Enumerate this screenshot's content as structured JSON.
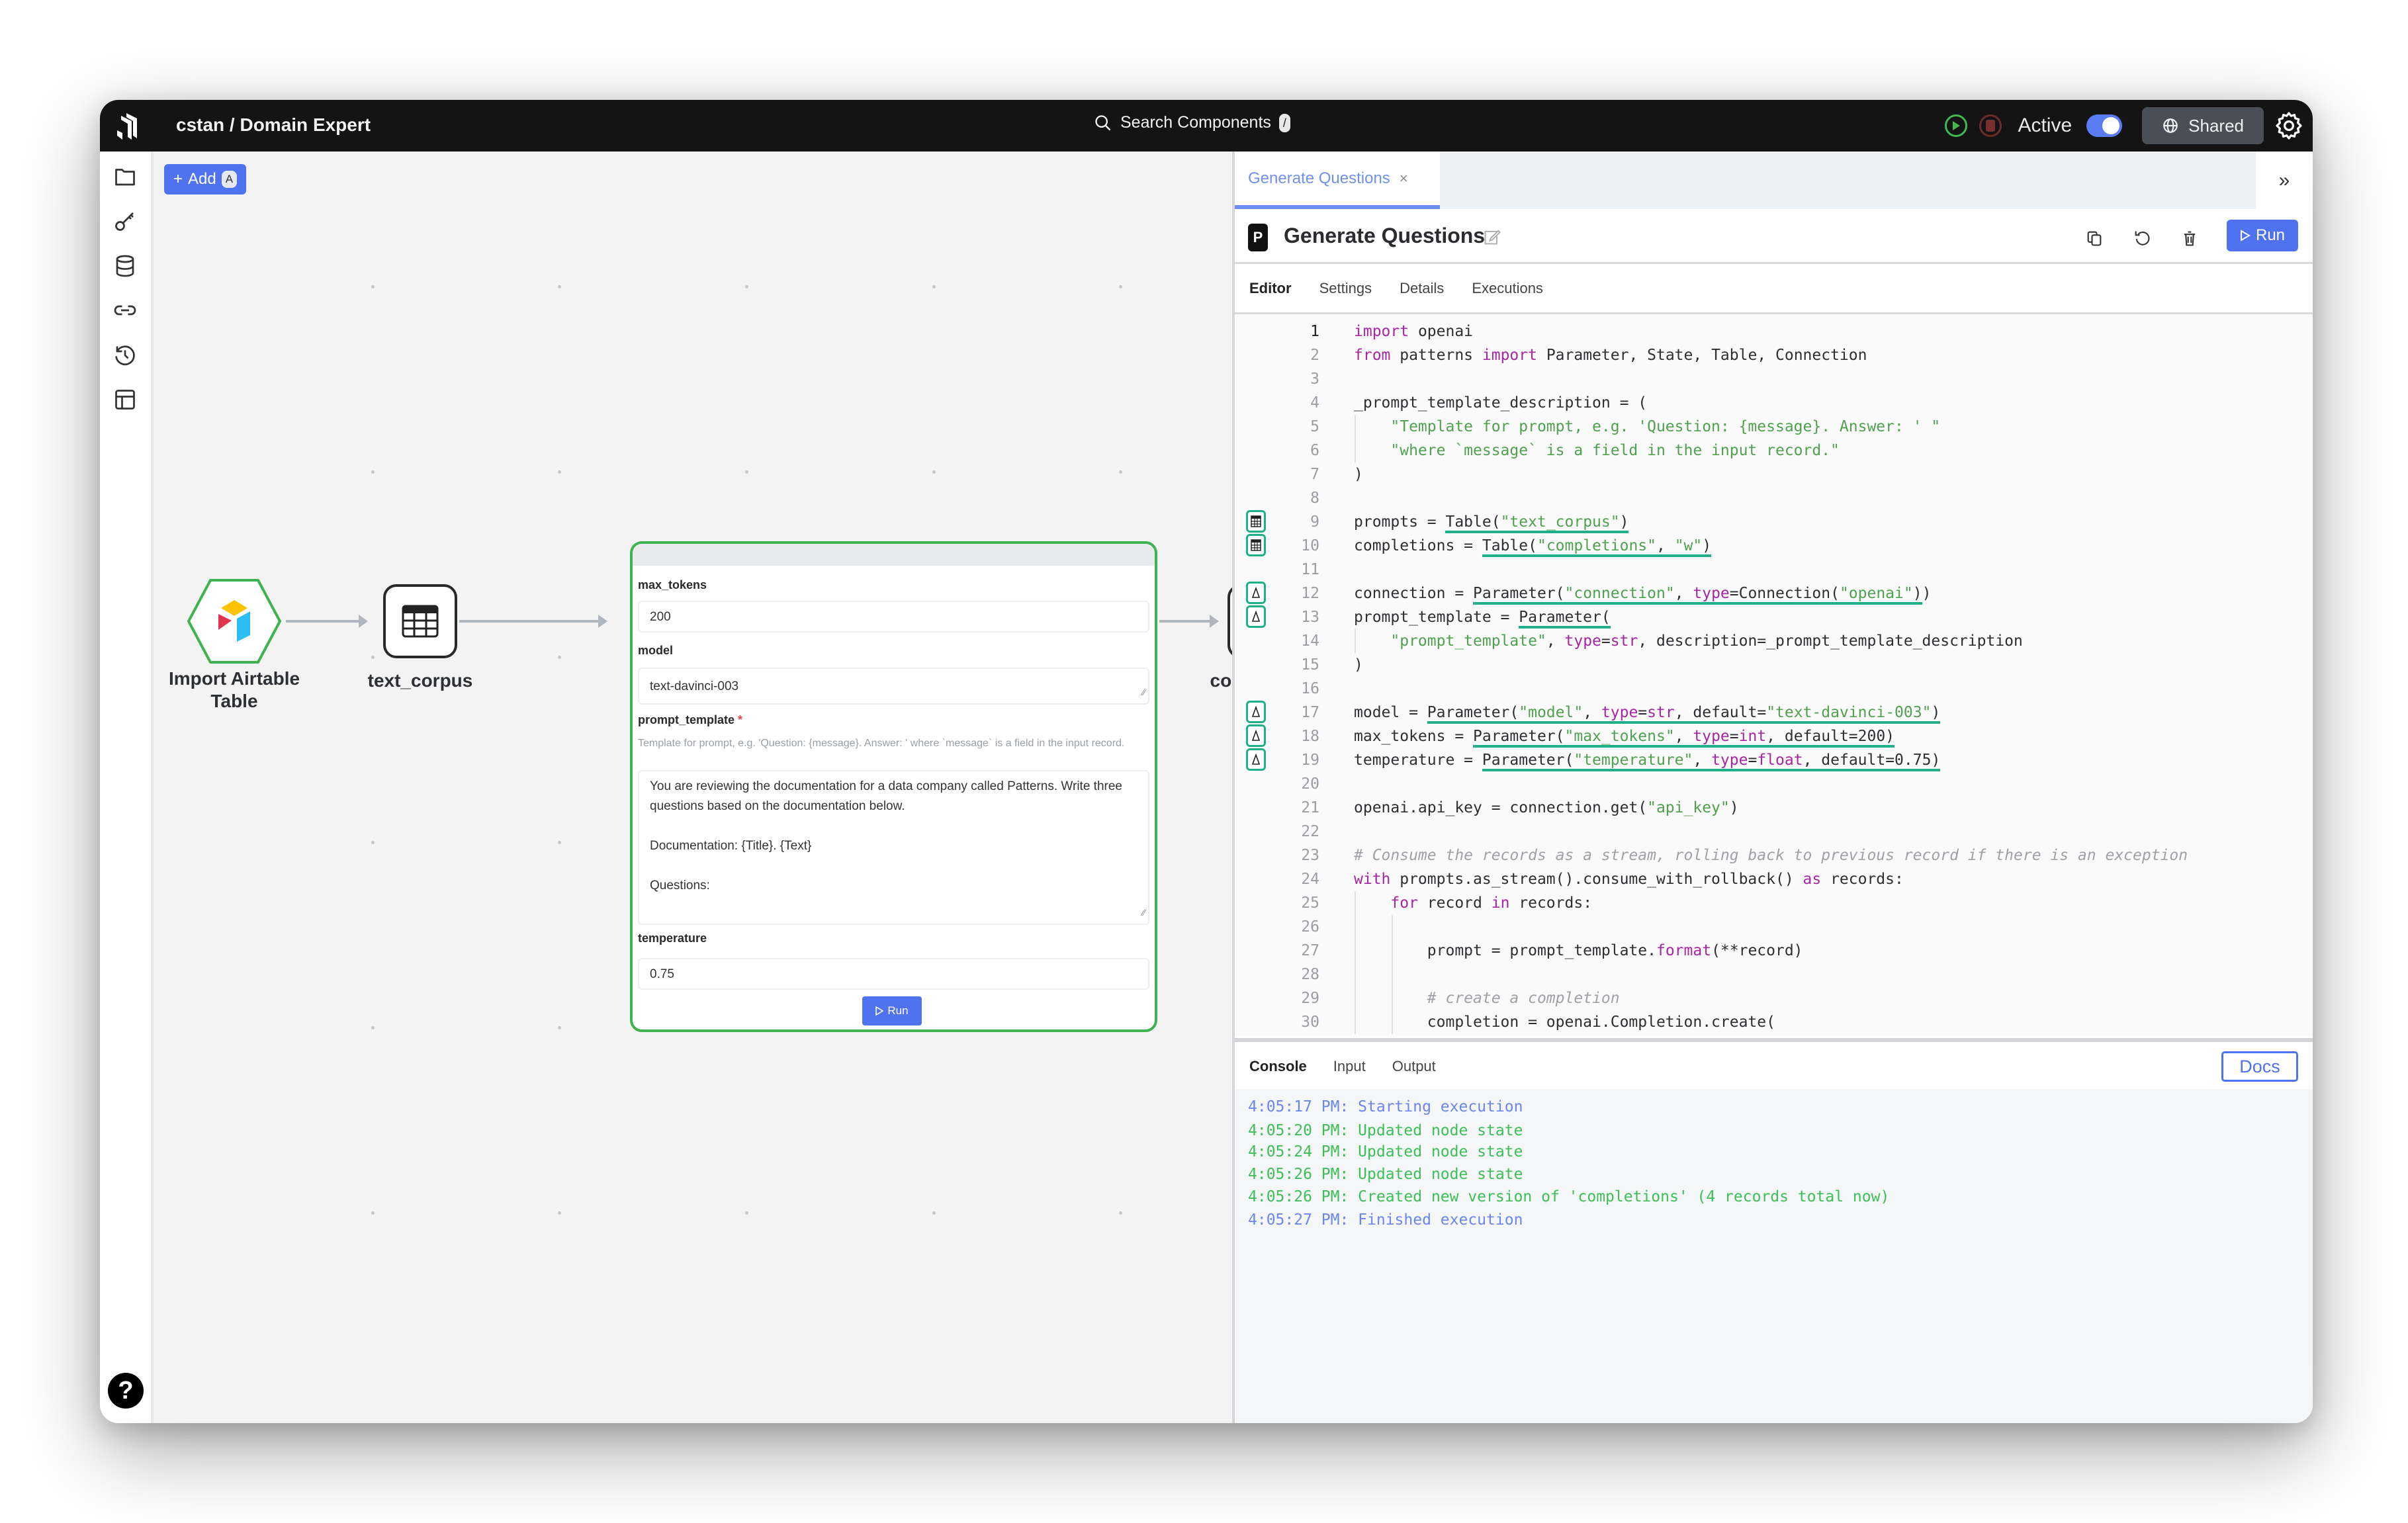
{
  "topbar": {
    "breadcrumb": "cstan / Domain Expert",
    "search_label": "Search Components",
    "search_shortcut": "/",
    "status_label": "Active",
    "active_toggle_on": true,
    "shared_label": "Shared"
  },
  "sidebar": {
    "items": [
      {
        "name": "files",
        "icon": "folder-icon"
      },
      {
        "name": "secrets",
        "icon": "key-icon"
      },
      {
        "name": "tables",
        "icon": "database-icon"
      },
      {
        "name": "connections",
        "icon": "link-icon"
      },
      {
        "name": "history",
        "icon": "history-icon"
      },
      {
        "name": "layout",
        "icon": "layout-icon"
      }
    ],
    "help_label": "?"
  },
  "canvas": {
    "add_label": "Add",
    "add_shortcut": "A",
    "nodes": [
      {
        "label_line1": "Import Airtable",
        "label_line2": "Table",
        "type": "airtable"
      },
      {
        "label": "text_corpus",
        "type": "table"
      },
      {
        "label": "completions",
        "type": "table"
      }
    ],
    "form": {
      "fields": [
        {
          "label": "max_tokens",
          "value": "200"
        },
        {
          "label": "model",
          "value": "text-davinci-003"
        },
        {
          "label": "prompt_template",
          "required": "*",
          "help": "Template for prompt, e.g. 'Question: {message}. Answer: ' where `message` is a field in the input record.",
          "value": "You are reviewing the documentation for a data company called Patterns. Write three questions based on the documentation below.\n\nDocumentation: {Title}. {Text}\n\nQuestions:"
        },
        {
          "label": "temperature",
          "value": "0.75"
        }
      ],
      "run_label": "Run"
    }
  },
  "panel": {
    "tab_label": "Generate Questions",
    "tab_close": "×",
    "expand_label": "»",
    "badge": "P",
    "title": "Generate Questions",
    "run_label": "Run",
    "subtabs": [
      "Editor",
      "Settings",
      "Details",
      "Executions"
    ],
    "active_subtab": "Editor",
    "code_lines": [
      {
        "n": "1"
      },
      {
        "n": "2"
      },
      {
        "n": "3"
      },
      {
        "n": "4"
      },
      {
        "n": "5"
      },
      {
        "n": "6"
      },
      {
        "n": "7"
      },
      {
        "n": "8"
      },
      {
        "n": "9"
      },
      {
        "n": "10"
      },
      {
        "n": "11"
      },
      {
        "n": "12"
      },
      {
        "n": "13"
      },
      {
        "n": "14"
      },
      {
        "n": "15"
      },
      {
        "n": "16"
      },
      {
        "n": "17"
      },
      {
        "n": "18"
      },
      {
        "n": "19"
      },
      {
        "n": "20"
      },
      {
        "n": "21"
      },
      {
        "n": "22"
      },
      {
        "n": "23"
      },
      {
        "n": "24"
      },
      {
        "n": "25"
      },
      {
        "n": "26"
      },
      {
        "n": "27"
      },
      {
        "n": "28"
      },
      {
        "n": "29"
      },
      {
        "n": "30"
      }
    ],
    "code": {
      "l1": [
        [
          "k",
          "import"
        ],
        [
          "t",
          " openai"
        ]
      ],
      "l2": [
        [
          "k",
          "from"
        ],
        [
          "t",
          " patterns "
        ],
        [
          "k",
          "import"
        ],
        [
          "t",
          " Parameter, State, Table, Connection"
        ]
      ],
      "l4": [
        [
          "t",
          "_prompt_template_description = ("
        ]
      ],
      "l5": [
        [
          "t",
          "    "
        ],
        [
          "s",
          "\"Template for prompt, e.g. 'Question: {message}. Answer: ' \""
        ]
      ],
      "l6": [
        [
          "t",
          "    "
        ],
        [
          "s",
          "\"where `message` is a field in the input record.\""
        ]
      ],
      "l7": [
        [
          "t",
          ")"
        ]
      ],
      "l9": [
        [
          "t",
          "prompts = "
        ],
        [
          "u",
          "Table(\"text_corpus\")"
        ]
      ],
      "l10": [
        [
          "t",
          "completions = "
        ],
        [
          "u",
          "Table(\"completions\", \"w\")"
        ]
      ],
      "l12": [
        [
          "t",
          "connection = "
        ],
        [
          "u",
          "Parameter(\"connection\", type=Connection(\"openai\")"
        ],
        [
          "t",
          ")"
        ]
      ],
      "l13": [
        [
          "t",
          "prompt_template = "
        ],
        [
          "u",
          "Parameter("
        ]
      ],
      "l14": [
        [
          "t",
          "    "
        ],
        [
          "s",
          "\"prompt_template\""
        ],
        [
          "t",
          ", "
        ],
        [
          "k",
          "type"
        ],
        [
          "t",
          "="
        ],
        [
          "k",
          "str"
        ],
        [
          "t",
          ", description=_prompt_template_description"
        ]
      ],
      "l15": [
        [
          "t",
          ")"
        ]
      ],
      "l17": [
        [
          "t",
          "model = "
        ],
        [
          "u",
          "Parameter(\"model\", type=str, default=\"text-davinci-003\")"
        ]
      ],
      "l18": [
        [
          "t",
          "max_tokens = "
        ],
        [
          "u",
          "Parameter(\"max_tokens\", type=int, default=200)"
        ]
      ],
      "l19": [
        [
          "t",
          "temperature = "
        ],
        [
          "u",
          "Parameter(\"temperature\", type=float, default=0.75)"
        ]
      ],
      "l21": [
        [
          "t",
          "openai.api_key = connection.get("
        ],
        [
          "s",
          "\"api_key\""
        ],
        [
          "t",
          ")"
        ]
      ],
      "l23": [
        [
          "c",
          "# Consume the records as a stream, rolling back to previous record if there is an exception"
        ]
      ],
      "l24": [
        [
          "k",
          "with"
        ],
        [
          "t",
          " prompts.as_stream().consume_with_rollback() "
        ],
        [
          "k",
          "as"
        ],
        [
          "t",
          " records:"
        ]
      ],
      "l25": [
        [
          "t",
          "    "
        ],
        [
          "k",
          "for"
        ],
        [
          "t",
          " record "
        ],
        [
          "k",
          "in"
        ],
        [
          "t",
          " records:"
        ]
      ],
      "l27": [
        [
          "t",
          "        prompt = prompt_template."
        ],
        [
          "k",
          "format"
        ],
        [
          "t",
          "(**record)"
        ]
      ],
      "l29": [
        [
          "t",
          "        "
        ],
        [
          "c",
          "# create a completion"
        ]
      ],
      "l30": [
        [
          "t",
          "        completion = openai.Completion.create("
        ]
      ]
    },
    "gutter_markers": [
      {
        "line": 9,
        "icon": "table-icon"
      },
      {
        "line": 10,
        "icon": "table-icon"
      },
      {
        "line": 12,
        "icon": "parameter-icon"
      },
      {
        "line": 13,
        "icon": "parameter-icon"
      },
      {
        "line": 17,
        "icon": "parameter-icon"
      },
      {
        "line": 18,
        "icon": "parameter-icon"
      },
      {
        "line": 19,
        "icon": "parameter-icon"
      }
    ],
    "console": {
      "tabs": [
        "Console",
        "Input",
        "Output"
      ],
      "active_tab": "Console",
      "docs_label": "Docs",
      "logs": [
        {
          "text": "4:05:17 PM: Starting execution",
          "level": "info"
        },
        {
          "text": "4:05:20 PM: Updated node state",
          "level": "ok"
        },
        {
          "text": "4:05:24 PM: Updated node state",
          "level": "ok"
        },
        {
          "text": "4:05:26 PM: Updated node state",
          "level": "ok"
        },
        {
          "text": "4:05:26 PM: Created new version of 'completions' (4 records total now)",
          "level": "ok"
        },
        {
          "text": "4:05:27 PM: Finished execution",
          "level": "info"
        }
      ]
    }
  },
  "colors": {
    "accent": "#4f72f0",
    "success": "#3fb34f",
    "underline": "#1fb08a",
    "keyword": "#a626a4",
    "string": "#50a14f"
  }
}
